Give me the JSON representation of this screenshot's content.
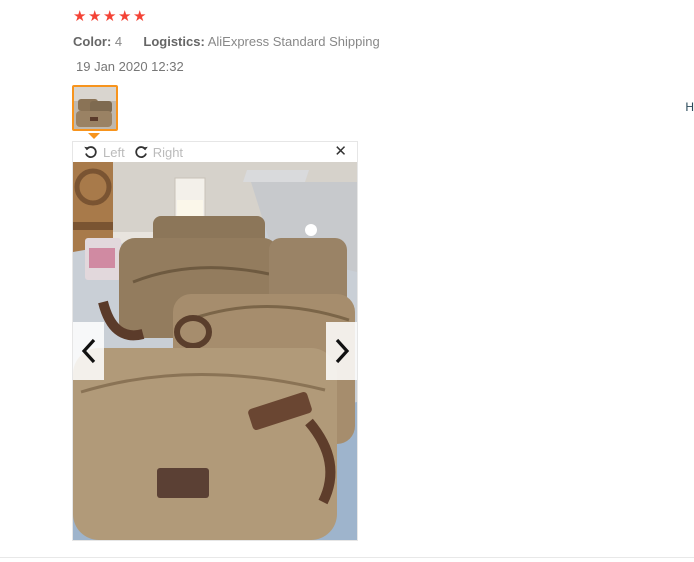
{
  "review": {
    "stars_count": 5,
    "star_glyph": "★",
    "color_label": "Color:",
    "color_value": "4",
    "logistics_label": "Logistics:",
    "logistics_value": "AliExpress Standard Shipping",
    "date": "19 Jan 2020 12:32"
  },
  "viewer": {
    "rotate_left_label": "Left",
    "rotate_right_label": "Right",
    "close_glyph": "✕"
  },
  "edge_text": "H",
  "colors": {
    "star": "#f44336",
    "thumb_border": "#f7941d",
    "toolbar_text": "#bbbbbb"
  }
}
